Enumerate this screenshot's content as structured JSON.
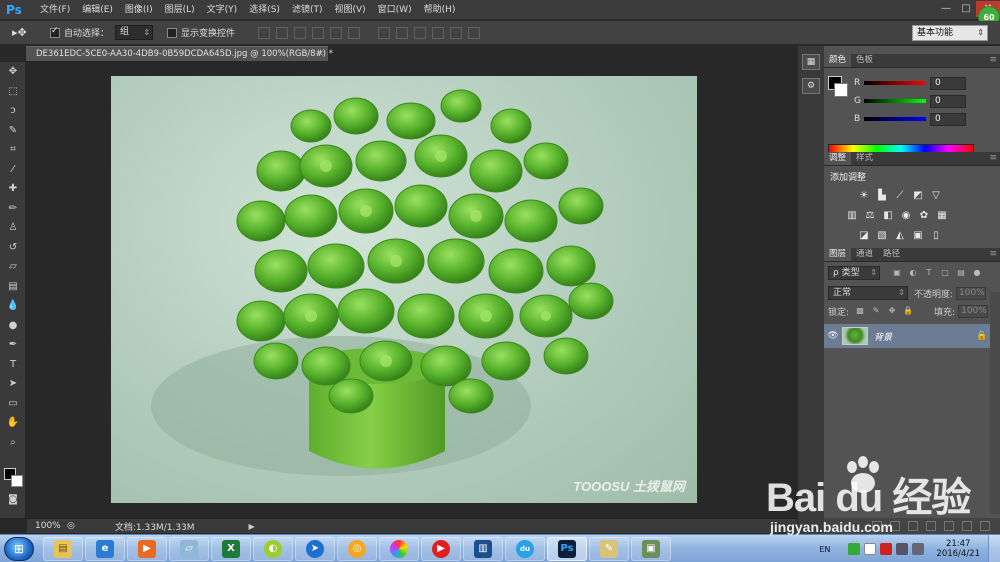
{
  "app": {
    "logo": "Ps",
    "badge": "60"
  },
  "menu": [
    "文件(F)",
    "编辑(E)",
    "图像(I)",
    "图层(L)",
    "文字(Y)",
    "选择(S)",
    "滤镜(T)",
    "视图(V)",
    "窗口(W)",
    "帮助(H)"
  ],
  "window_controls": {
    "minimize": "—",
    "restore": "□",
    "close": "✕"
  },
  "options": {
    "auto_select_label": "自动选择：",
    "auto_select_checked": true,
    "auto_select_value": "组",
    "show_transform_label": "显示变换控件",
    "show_transform_checked": false,
    "workspace": "基本功能"
  },
  "document": {
    "tab_title": "DE361EDC-5CE0-AA30-4DB9-0B59DCDA645D.jpg @ 100%(RGB/8#) *",
    "tab_close": "×",
    "watermark": "TOOOSU 土拨鼠网",
    "zoom": "100%",
    "doc_info": "文档:1.33M/1.33M"
  },
  "color_panel": {
    "tabs": [
      "颜色",
      "色板"
    ],
    "r_label": "R",
    "r_value": "0",
    "g_label": "G",
    "g_value": "0",
    "b_label": "B",
    "b_value": "0"
  },
  "adjustments_panel": {
    "tabs": [
      "调整",
      "样式"
    ],
    "title": "添加调整"
  },
  "layers_panel": {
    "tabs": [
      "图层",
      "通道",
      "路径"
    ],
    "kind_filter": "ρ 类型",
    "blend_mode": "正常",
    "opacity_label": "不透明度:",
    "opacity_value": "100%",
    "lock_label": "锁定:",
    "fill_label": "填充:",
    "fill_value": "100%",
    "layers": [
      {
        "name": "背景",
        "visible": true,
        "locked": true
      }
    ]
  },
  "taskbar": {
    "lang": "EN",
    "time": "21:47",
    "date": "2016/4/21"
  },
  "overlay": {
    "baidu_logo": "Bai du 经验",
    "baidu_url": "jingyan.baidu.com"
  }
}
